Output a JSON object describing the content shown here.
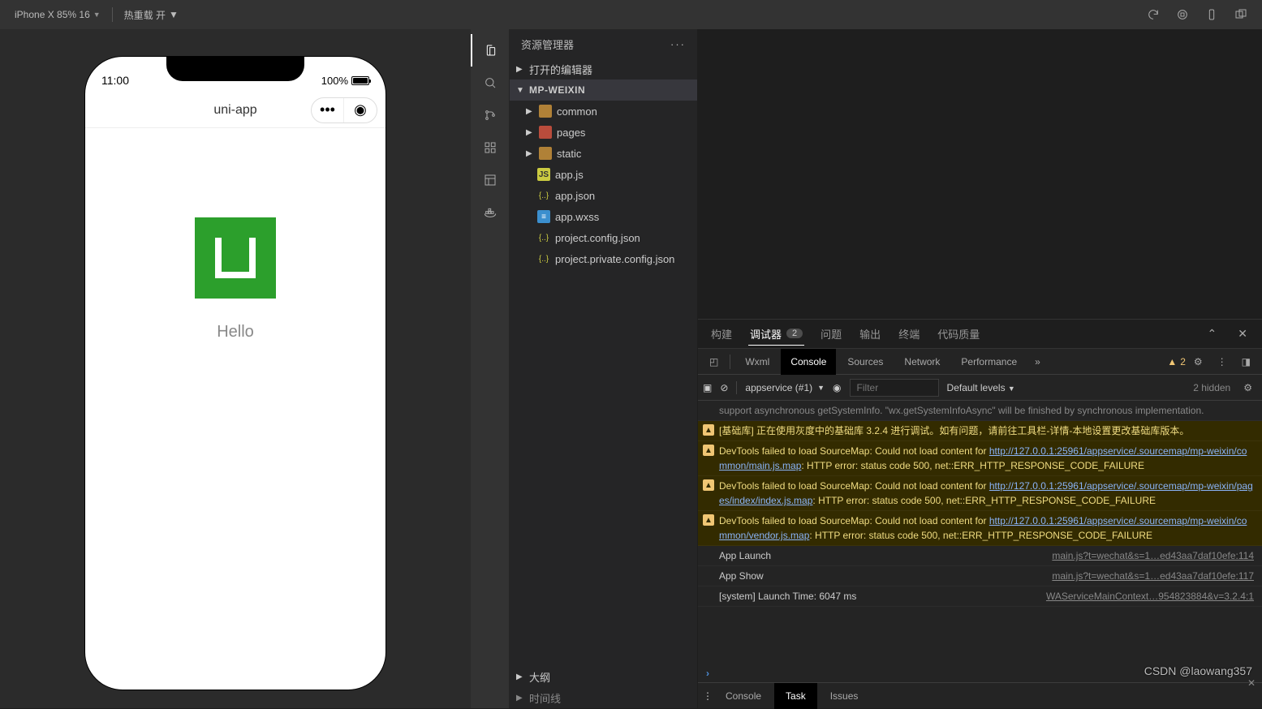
{
  "topbar": {
    "device": "iPhone X 85% 16",
    "hotreload": "热重载 开"
  },
  "simulator": {
    "time": "11:00",
    "battery": "100%",
    "app_title": "uni-app",
    "hello": "Hello"
  },
  "explorer": {
    "title": "资源管理器",
    "open_editors": "打开的编辑器",
    "project": "MP-WEIXIN",
    "folders": [
      {
        "name": "common",
        "kind": "folder"
      },
      {
        "name": "pages",
        "kind": "folder-red"
      },
      {
        "name": "static",
        "kind": "folder"
      }
    ],
    "files": [
      {
        "name": "app.js",
        "kind": "js"
      },
      {
        "name": "app.json",
        "kind": "json"
      },
      {
        "name": "app.wxss",
        "kind": "css"
      },
      {
        "name": "project.config.json",
        "kind": "json"
      },
      {
        "name": "project.private.config.json",
        "kind": "json"
      }
    ],
    "outline": "大纲",
    "timeline": "时间线"
  },
  "panel_tabs": {
    "build": "构建",
    "debugger": "调试器",
    "debugger_badge": "2",
    "issues": "问题",
    "output": "输出",
    "terminal": "终端",
    "code_quality": "代码质量"
  },
  "devtools": {
    "tabs": {
      "wxml": "Wxml",
      "console": "Console",
      "sources": "Sources",
      "network": "Network",
      "performance": "Performance"
    },
    "warn_count": "2",
    "context": "appservice (#1)",
    "filter_placeholder": "Filter",
    "levels": "Default levels",
    "hidden": "2 hidden",
    "footer": {
      "console": "Console",
      "task": "Task",
      "issues": "Issues"
    }
  },
  "console_log": [
    {
      "type": "trunc",
      "text": "support asynchronous getSystemInfo. \"wx.getSystemInfoAsync\" will be finished by synchronous implementation."
    },
    {
      "type": "warn",
      "text": "[基础库] 正在使用灰度中的基础库 3.2.4 进行调试。如有问题，请前往工具栏-详情-本地设置更改基础库版本。"
    },
    {
      "type": "warn",
      "text": "DevTools failed to load SourceMap: Could not load content for ",
      "link": "http://127.0.0.1:25961/appservice/.sourcemap/mp-weixin/common/main.js.map",
      "suffix": ": HTTP error: status code 500, net::ERR_HTTP_RESPONSE_CODE_FAILURE"
    },
    {
      "type": "warn",
      "text": "DevTools failed to load SourceMap: Could not load content for ",
      "link": "http://127.0.0.1:25961/appservice/.sourcemap/mp-weixin/pages/index/index.js.map",
      "suffix": ": HTTP error: status code 500, net::ERR_HTTP_RESPONSE_CODE_FAILURE"
    },
    {
      "type": "warn",
      "text": "DevTools failed to load SourceMap: Could not load content for ",
      "link": "http://127.0.0.1:25961/appservice/.sourcemap/mp-weixin/common/vendor.js.map",
      "suffix": ": HTTP error: status code 500, net::ERR_HTTP_RESPONSE_CODE_FAILURE"
    },
    {
      "type": "info",
      "text": "App Launch",
      "src": "main.js?t=wechat&s=1…ed43aa7daf10efe:114"
    },
    {
      "type": "info",
      "text": "App Show",
      "src": "main.js?t=wechat&s=1…ed43aa7daf10efe:117"
    },
    {
      "type": "info",
      "text": "[system] Launch Time: 6047 ms",
      "src": "WAServiceMainContext…954823884&v=3.2.4:1"
    }
  ],
  "watermark": "CSDN @laowang357"
}
